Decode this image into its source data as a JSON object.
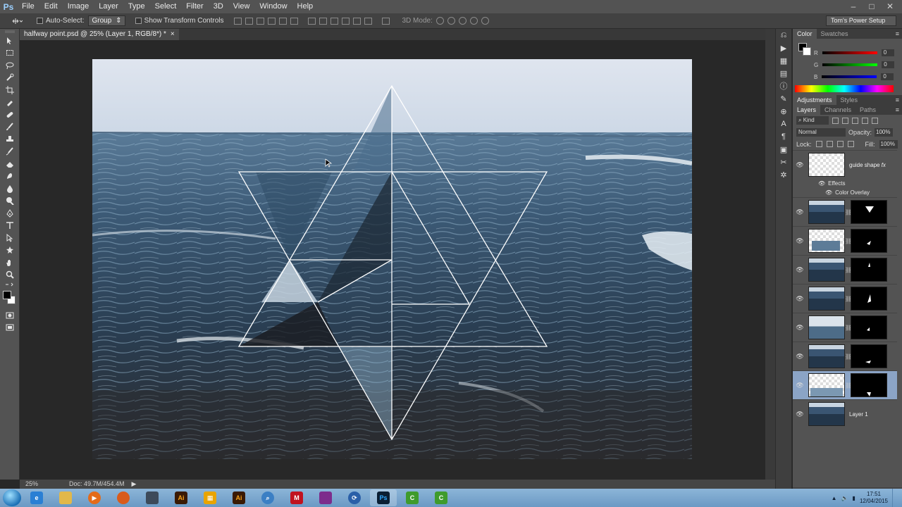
{
  "app": {
    "logo": "Ps"
  },
  "menu": [
    "File",
    "Edit",
    "Image",
    "Layer",
    "Type",
    "Select",
    "Filter",
    "3D",
    "View",
    "Window",
    "Help"
  ],
  "window_controls": {
    "minimize": "–",
    "maximize": "□",
    "close": "✕"
  },
  "options_bar": {
    "auto_select_label": "Auto-Select:",
    "auto_select_target": "Group",
    "show_transform_label": "Show Transform Controls",
    "mode_3d_label": "3D Mode:",
    "workspace": "Tom's Power Setup"
  },
  "document": {
    "tab_title": "halfway point.psd @ 25% (Layer 1, RGB/8*) *",
    "tab_close": "×"
  },
  "status_bar": {
    "zoom": "25%",
    "doc_size": "Doc: 49.7M/454.4M"
  },
  "color_panel": {
    "tabs": [
      "Color",
      "Swatches"
    ],
    "sliders": [
      {
        "label": "R",
        "value": "0"
      },
      {
        "label": "G",
        "value": "0"
      },
      {
        "label": "B",
        "value": "0"
      }
    ]
  },
  "adjustments_tabs": [
    "Adjustments",
    "Styles"
  ],
  "layers_panel": {
    "tabs": [
      "Layers",
      "Channels",
      "Paths"
    ],
    "kind_filter": "Kind",
    "blend_mode": "Normal",
    "opacity_label": "Opacity:",
    "opacity": "100%",
    "lock_label": "Lock:",
    "fill_label": "Fill:",
    "fill": "100%",
    "layers": [
      {
        "name": "guide shape",
        "fx": "fx",
        "effects_label": "Effects",
        "effect": "Color Overlay"
      },
      {
        "name": ""
      },
      {
        "name": ""
      },
      {
        "name": ""
      },
      {
        "name": ""
      },
      {
        "name": ""
      },
      {
        "name": ""
      },
      {
        "name": ""
      },
      {
        "name": "Layer 1"
      }
    ]
  },
  "taskbar": {
    "clock_time": "17:51",
    "clock_date": "12/04/2015",
    "apps": [
      "ie-icon",
      "explorer-icon",
      "media-player-icon",
      "firefox-icon",
      "app-icon",
      "illustrator-icon",
      "grid-icon",
      "illustrator-icon-2",
      "search-icon",
      "mcafee-icon",
      "winrar-icon",
      "sync-icon",
      "photoshop-icon",
      "camtasia-icon",
      "camtasia-icon-2"
    ]
  },
  "colors": {
    "ui_dark": "#535353",
    "selection": "#8ba4c6",
    "guide_line": "#ffffff"
  }
}
